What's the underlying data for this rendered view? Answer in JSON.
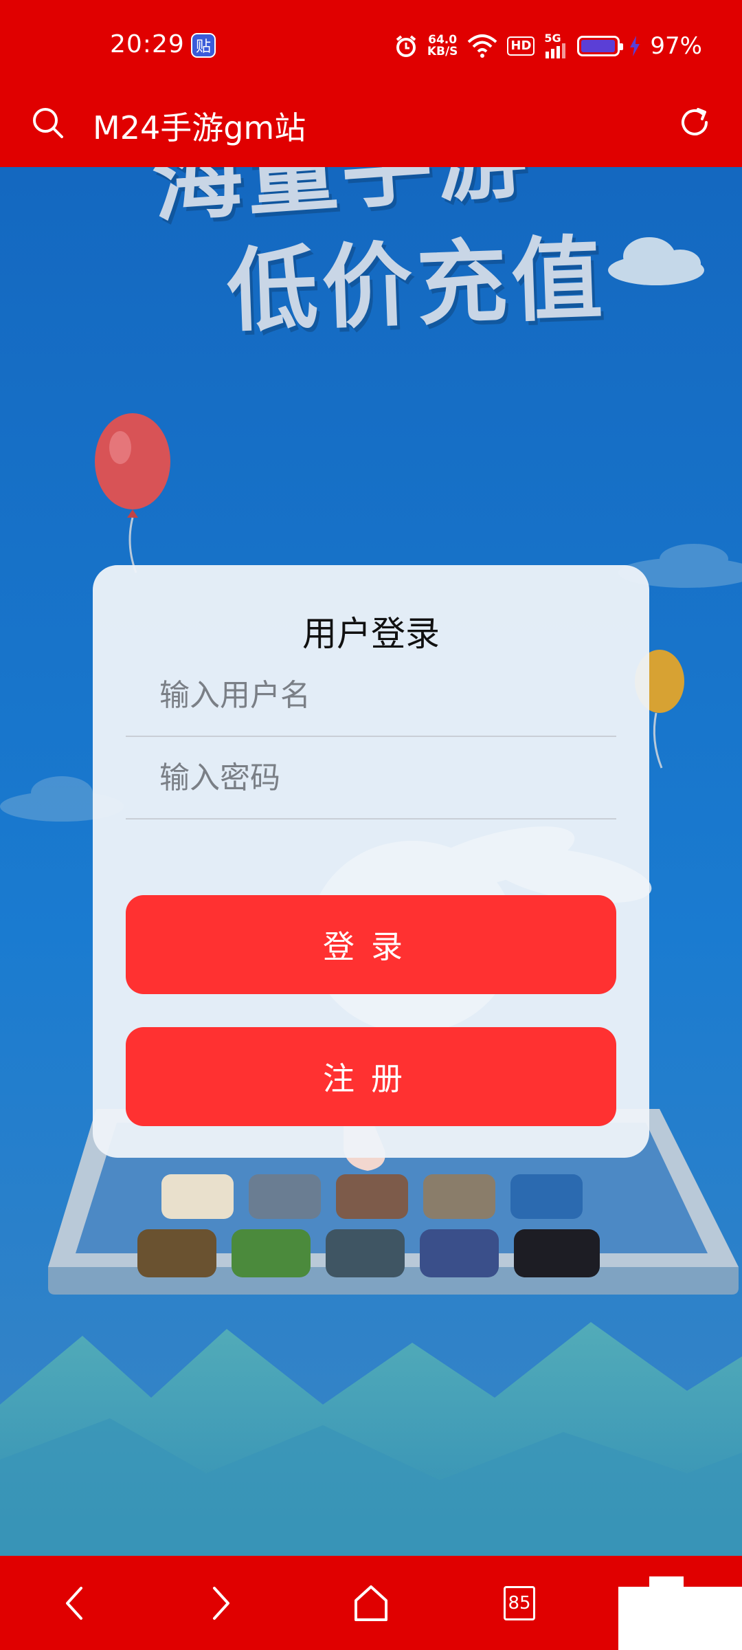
{
  "status_bar": {
    "time": "20:29",
    "app_badge": "贴",
    "net_speed_value": "64.0",
    "net_speed_unit": "KB/S",
    "hd_label": "HD",
    "signal_label": "5G",
    "battery_level": 0.97,
    "battery_pct": "97%"
  },
  "header": {
    "title": "M24手游gm站",
    "search_icon": "search-icon",
    "refresh_icon": "refresh-icon"
  },
  "banner": {
    "headline_1": "海量手游",
    "headline_2": "低价充值"
  },
  "login": {
    "title": "用户登录",
    "username_placeholder": "输入用户名",
    "username_value": "",
    "password_placeholder": "输入密码",
    "password_value": "",
    "login_label": "登录",
    "register_label": "注册"
  },
  "bottom_nav": {
    "tabs_count": "85"
  },
  "colors": {
    "bar_red": "#e00000",
    "button_red": "#ff3131",
    "background_blue": "#1674c9"
  }
}
